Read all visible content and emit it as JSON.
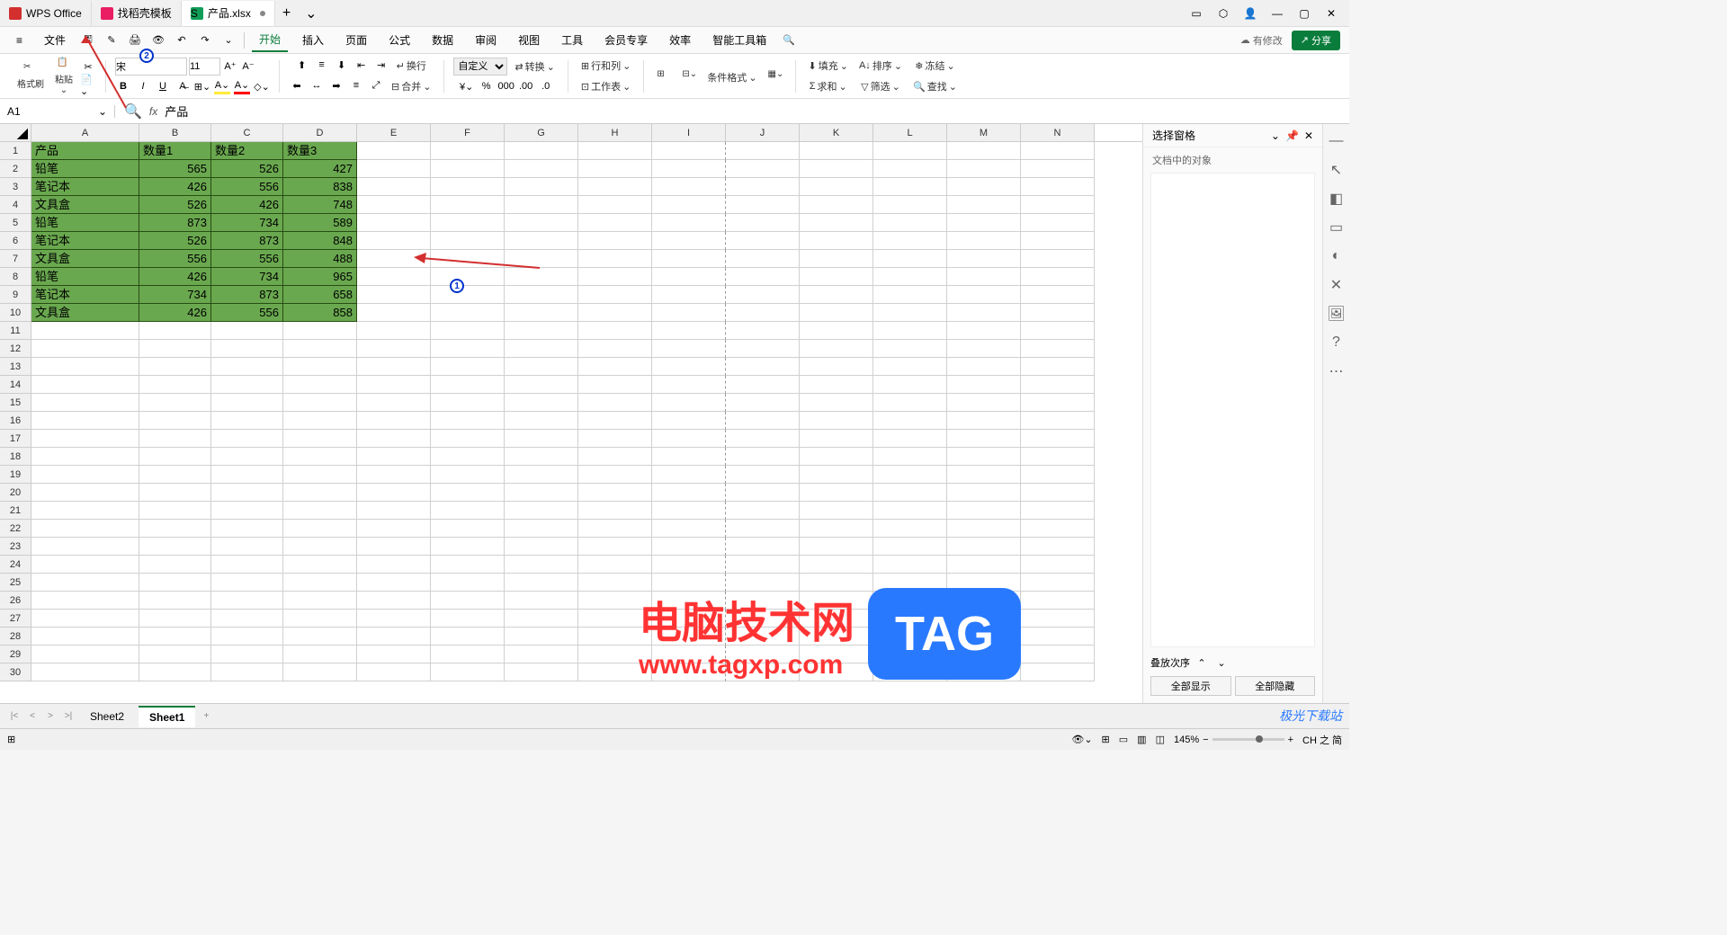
{
  "titlebar": {
    "tabs": [
      {
        "icon": "wps",
        "label": "WPS Office"
      },
      {
        "icon": "template",
        "label": "找稻壳模板"
      },
      {
        "icon": "sheet",
        "label": "产品.xlsx",
        "active": true,
        "modified": true
      }
    ]
  },
  "menubar": {
    "file": "文件",
    "items": [
      "开始",
      "插入",
      "页面",
      "公式",
      "数据",
      "审阅",
      "视图",
      "工具",
      "会员专享",
      "效率",
      "智能工具箱"
    ],
    "active_index": 0,
    "edit_status": "有修改",
    "share": "分享"
  },
  "toolbar": {
    "format_painter": "格式刷",
    "paste": "粘贴",
    "font_name": "宋",
    "font_size": "11",
    "custom": "自定义",
    "convert": "转换",
    "rowcol": "行和列",
    "worksheet": "工作表",
    "cond_format": "条件格式",
    "fill": "填充",
    "sort": "排序",
    "freeze": "冻结",
    "sum": "求和",
    "filter": "筛选",
    "find": "查找",
    "merge": "合并",
    "wrap": "换行"
  },
  "formulabar": {
    "cell_ref": "A1",
    "fx": "fx",
    "value": "产品"
  },
  "columns": [
    "A",
    "B",
    "C",
    "D",
    "E",
    "F",
    "G",
    "H",
    "I",
    "J",
    "K",
    "L",
    "M",
    "N"
  ],
  "sheet_data": {
    "headers": [
      "产品",
      "数量1",
      "数量2",
      "数量3"
    ],
    "rows": [
      [
        "铅笔",
        565,
        526,
        427
      ],
      [
        "笔记本",
        426,
        556,
        838
      ],
      [
        "文具盒",
        526,
        426,
        748
      ],
      [
        "铅笔",
        873,
        734,
        589
      ],
      [
        "笔记本",
        526,
        873,
        848
      ],
      [
        "文具盒",
        556,
        556,
        488
      ],
      [
        "铅笔",
        426,
        734,
        965
      ],
      [
        "笔记本",
        734,
        873,
        658
      ],
      [
        "文具盒",
        426,
        556,
        858
      ]
    ]
  },
  "visible_rows": 30,
  "sidepanel": {
    "title": "选择窗格",
    "subtitle": "文档中的对象",
    "stack_label": "叠放次序",
    "show_all": "全部显示",
    "hide_all": "全部隐藏"
  },
  "sheettabs": {
    "tabs": [
      "Sheet2",
      "Sheet1"
    ],
    "active_index": 1
  },
  "statusbar": {
    "zoom": "145%",
    "ime": "CH 之 简"
  },
  "annotations": {
    "circle1": "1",
    "circle2": "2"
  },
  "watermark": {
    "text1": "电脑技术网",
    "text2": "www.tagxp.com",
    "tag": "TAG",
    "jg": "极光下载站"
  }
}
